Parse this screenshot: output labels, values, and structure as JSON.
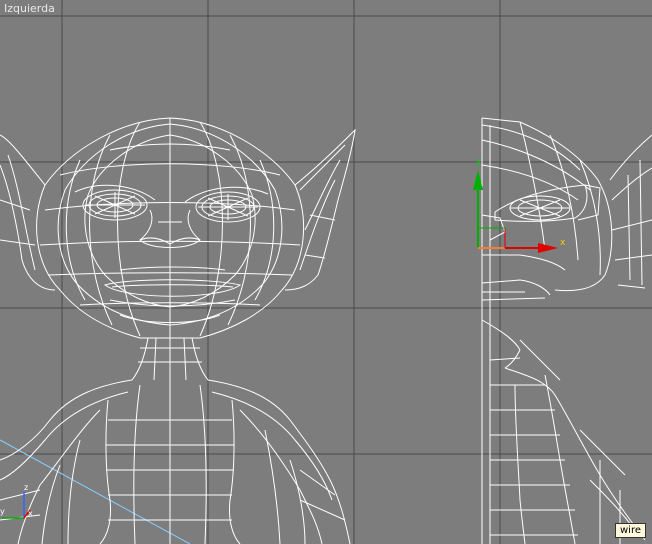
{
  "viewport": {
    "label": "Izquierda",
    "render_mode": "wire"
  },
  "gizmo": {
    "axis_x": "x",
    "axis_y": "y",
    "corner_axis_x": "x",
    "corner_axis_z": "z",
    "corner_axis_y": "y"
  },
  "colors": {
    "background": "#7d7d7d",
    "grid": "#4a4a4a",
    "wire": "#ffffff",
    "axis_x": "#e00000",
    "axis_y": "#00b000",
    "selection_line": "#88ccff"
  }
}
